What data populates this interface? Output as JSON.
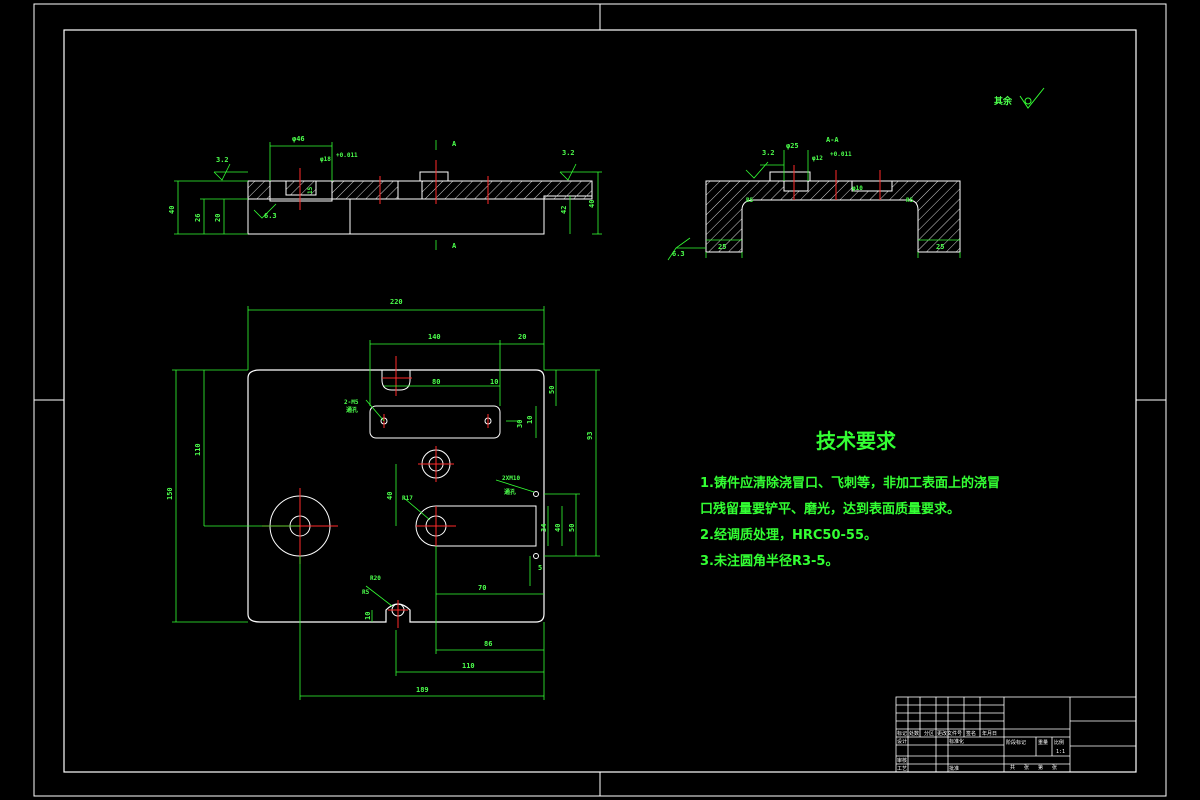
{
  "colors": {
    "background": "#000000",
    "outline": "#ffffff",
    "dimension": "#33ff33",
    "centerline": "#ff2a2a",
    "hatch": "#d0d0d0"
  },
  "roughness_note": "其余",
  "section_view": {
    "cut_mark_top": "A",
    "cut_mark_bottom": "A",
    "dia_46": "φ46",
    "dia_18": "φ18",
    "fit_h11": "+0.011",
    "roughness_left": "3.2",
    "roughness_right": "3.2",
    "roughness_bottom": "6.3",
    "h_total": "40",
    "h_26": "26",
    "h_20": "20",
    "h_42": "42",
    "h_right": "40",
    "small_dim": "15"
  },
  "side_view": {
    "title": "A-A",
    "dia_25": "φ25",
    "dia_12": "φ12",
    "fit_h11": "+0.011",
    "dia_10": "φ10",
    "roughness_top": "3.2",
    "roughness_bottom": "6.3",
    "bottom_left": "25",
    "bottom_right": "25",
    "r_left": "R5",
    "r_right": "R5"
  },
  "plan_view": {
    "w_220": "220",
    "w_140": "140",
    "w_20": "20",
    "w_80": "80",
    "w_10": "10",
    "w_70": "70",
    "w_86": "86",
    "w_110": "110",
    "w_189": "189",
    "h_150": "150",
    "h_110": "110",
    "h_40": "40",
    "h_50": "50",
    "h_10": "10",
    "h_30": "30",
    "h_93": "93",
    "h_34": "34",
    "h_40b": "40",
    "h_50b": "50",
    "h_5": "5",
    "h_10b": "10",
    "thread_note": "2-M5",
    "thread_note2": "通孔",
    "thread_note3": "2XM10",
    "thread_note4": "通孔",
    "r17": "R17",
    "r20": "R20",
    "r5": "R5"
  },
  "requirements": {
    "title": "技术要求",
    "items": [
      "1.铸件应清除浇冒口、飞刺等，非加工表面上的浇冒",
      "口残留量要铲平、磨光，达到表面质量要求。",
      "2.经调质处理，HRC50-55。",
      "3.未注圆角半径R3-5。"
    ]
  },
  "title_block": {
    "row1": [
      "标记",
      "处数",
      "分区",
      "更改文件号",
      "签名",
      "年月日"
    ],
    "row2": [
      "设计",
      "",
      "标准化",
      ""
    ],
    "row3": [
      "审核",
      ""
    ],
    "row4": [
      "工艺",
      "",
      "批准",
      ""
    ],
    "mid": [
      "阶段标记",
      "重量",
      "比例"
    ],
    "scale": "1:1",
    "sheet": [
      "共",
      "张",
      "第",
      "张"
    ]
  }
}
